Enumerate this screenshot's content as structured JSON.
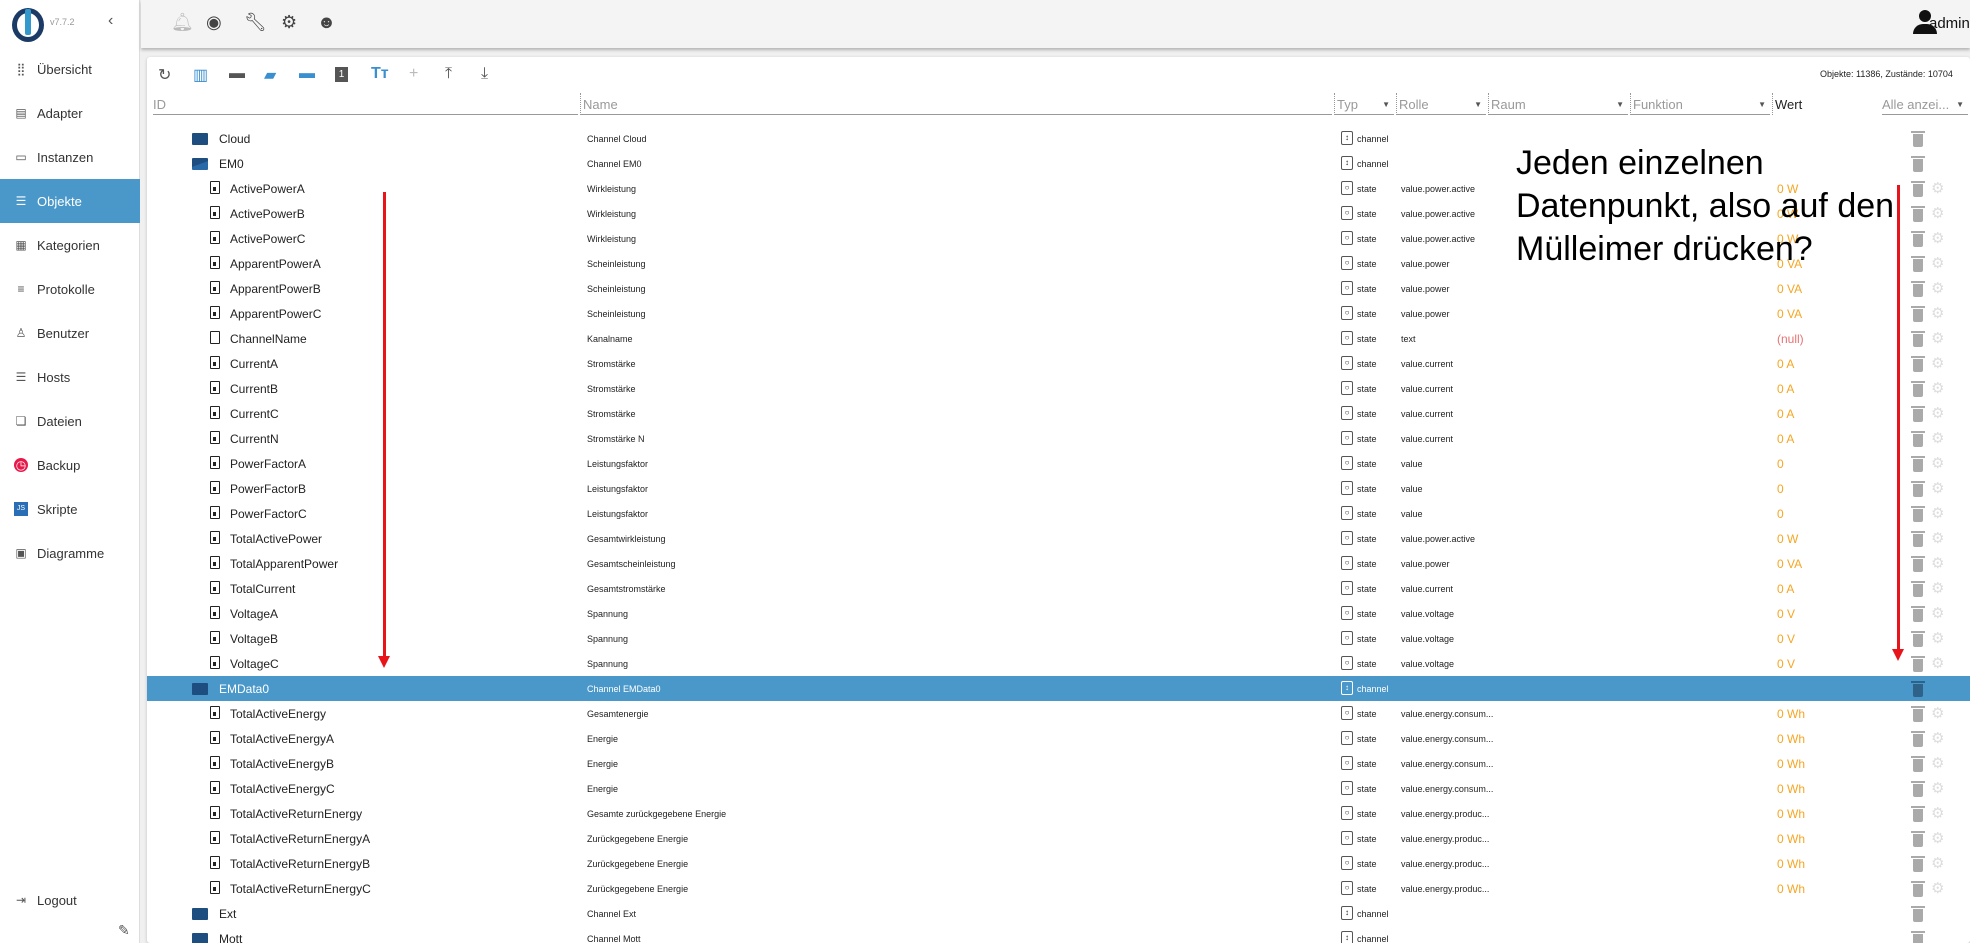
{
  "app": {
    "version": "v7.7.2",
    "user": "admin"
  },
  "sidebar": {
    "items": [
      {
        "label": "Übersicht",
        "icon": "grid-icon"
      },
      {
        "label": "Adapter",
        "icon": "store-icon"
      },
      {
        "label": "Instanzen",
        "icon": "instances-icon"
      },
      {
        "label": "Objekte",
        "icon": "list-icon",
        "selected": true
      },
      {
        "label": "Kategorien",
        "icon": "categories-icon"
      },
      {
        "label": "Protokolle",
        "icon": "log-icon"
      },
      {
        "label": "Benutzer",
        "icon": "user-icon"
      },
      {
        "label": "Hosts",
        "icon": "hosts-icon"
      },
      {
        "label": "Dateien",
        "icon": "files-icon"
      },
      {
        "label": "Backup",
        "icon": "backup-icon"
      },
      {
        "label": "Skripte",
        "icon": "js-icon"
      },
      {
        "label": "Diagramme",
        "icon": "chart-icon"
      }
    ],
    "logout": "Logout"
  },
  "topbar": {
    "icons": [
      "bell-icon",
      "eye-icon",
      "wrench-icon",
      "gear-icon",
      "expert-head-icon"
    ]
  },
  "toolbar": {
    "icons": [
      "refresh-icon",
      "columns-icon",
      "folder-icon",
      "folder-open-icon",
      "folder-blue-icon",
      "number-icon",
      "text-size-icon",
      "add-icon",
      "upload-icon",
      "download-icon"
    ],
    "count": "Objekte: 11386, Zustände: 10704"
  },
  "columns": {
    "id": "ID",
    "name": "Name",
    "typ": "Typ",
    "rolle": "Rolle",
    "raum": "Raum",
    "funktion": "Funktion",
    "wert": "Wert",
    "filter": "Alle anzei..."
  },
  "colors": {
    "accent": "#4a98c9",
    "value": "#f5a623",
    "null": "#e57373",
    "arrow": "#e8141b"
  },
  "rows": [
    {
      "id": "Cloud",
      "name": "Channel Cloud",
      "type": "channel",
      "kind": "folder"
    },
    {
      "id": "EM0",
      "name": "Channel EM0",
      "type": "channel",
      "kind": "folder-open"
    },
    {
      "id": "ActivePowerA",
      "name": "Wirkleistung",
      "type": "state",
      "role": "value.power.active",
      "value": "0 W"
    },
    {
      "id": "ActivePowerB",
      "name": "Wirkleistung",
      "type": "state",
      "role": "value.power.active",
      "value": "0 W"
    },
    {
      "id": "ActivePowerC",
      "name": "Wirkleistung",
      "type": "state",
      "role": "value.power.active",
      "value": "0 W"
    },
    {
      "id": "ApparentPowerA",
      "name": "Scheinleistung",
      "type": "state",
      "role": "value.power",
      "value": "0 VA"
    },
    {
      "id": "ApparentPowerB",
      "name": "Scheinleistung",
      "type": "state",
      "role": "value.power",
      "value": "0 VA"
    },
    {
      "id": "ApparentPowerC",
      "name": "Scheinleistung",
      "type": "state",
      "role": "value.power",
      "value": "0 VA"
    },
    {
      "id": "ChannelName",
      "name": "Kanalname",
      "type": "state",
      "role": "text",
      "value": "(null)",
      "plain": true
    },
    {
      "id": "CurrentA",
      "name": "Stromstärke",
      "type": "state",
      "role": "value.current",
      "value": "0 A"
    },
    {
      "id": "CurrentB",
      "name": "Stromstärke",
      "type": "state",
      "role": "value.current",
      "value": "0 A"
    },
    {
      "id": "CurrentC",
      "name": "Stromstärke",
      "type": "state",
      "role": "value.current",
      "value": "0 A"
    },
    {
      "id": "CurrentN",
      "name": "Stromstärke N",
      "type": "state",
      "role": "value.current",
      "value": "0 A"
    },
    {
      "id": "PowerFactorA",
      "name": "Leistungsfaktor",
      "type": "state",
      "role": "value",
      "value": "0"
    },
    {
      "id": "PowerFactorB",
      "name": "Leistungsfaktor",
      "type": "state",
      "role": "value",
      "value": "0"
    },
    {
      "id": "PowerFactorC",
      "name": "Leistungsfaktor",
      "type": "state",
      "role": "value",
      "value": "0"
    },
    {
      "id": "TotalActivePower",
      "name": "Gesamtwirkleistung",
      "type": "state",
      "role": "value.power.active",
      "value": "0 W"
    },
    {
      "id": "TotalApparentPower",
      "name": "Gesamtscheinleistung",
      "type": "state",
      "role": "value.power",
      "value": "0 VA"
    },
    {
      "id": "TotalCurrent",
      "name": "Gesamtstromstärke",
      "type": "state",
      "role": "value.current",
      "value": "0 A"
    },
    {
      "id": "VoltageA",
      "name": "Spannung",
      "type": "state",
      "role": "value.voltage",
      "value": "0 V"
    },
    {
      "id": "VoltageB",
      "name": "Spannung",
      "type": "state",
      "role": "value.voltage",
      "value": "0 V"
    },
    {
      "id": "VoltageC",
      "name": "Spannung",
      "type": "state",
      "role": "value.voltage",
      "value": "0 V"
    },
    {
      "id": "EMData0",
      "name": "Channel EMData0",
      "type": "channel",
      "kind": "folder-open",
      "selected": true
    },
    {
      "id": "TotalActiveEnergy",
      "name": "Gesamtenergie",
      "type": "state",
      "role": "value.energy.consum...",
      "value": "0 Wh"
    },
    {
      "id": "TotalActiveEnergyA",
      "name": "Energie",
      "type": "state",
      "role": "value.energy.consum...",
      "value": "0 Wh"
    },
    {
      "id": "TotalActiveEnergyB",
      "name": "Energie",
      "type": "state",
      "role": "value.energy.consum...",
      "value": "0 Wh"
    },
    {
      "id": "TotalActiveEnergyC",
      "name": "Energie",
      "type": "state",
      "role": "value.energy.consum...",
      "value": "0 Wh"
    },
    {
      "id": "TotalActiveReturnEnergy",
      "name": "Gesamte zurückgegebene Energie",
      "type": "state",
      "role": "value.energy.produc...",
      "value": "0 Wh"
    },
    {
      "id": "TotalActiveReturnEnergyA",
      "name": "Zurückgegebene Energie",
      "type": "state",
      "role": "value.energy.produc...",
      "value": "0 Wh"
    },
    {
      "id": "TotalActiveReturnEnergyB",
      "name": "Zurückgegebene Energie",
      "type": "state",
      "role": "value.energy.produc...",
      "value": "0 Wh"
    },
    {
      "id": "TotalActiveReturnEnergyC",
      "name": "Zurückgegebene Energie",
      "type": "state",
      "role": "value.energy.produc...",
      "value": "0 Wh"
    },
    {
      "id": "Ext",
      "name": "Channel Ext",
      "type": "channel",
      "kind": "folder"
    },
    {
      "id": "Mott",
      "name": "Channel Mott",
      "type": "channel",
      "kind": "folder"
    }
  ],
  "annotation": "Jeden einzelnen Datenpunkt, also auf den Mülleimer drücken?"
}
